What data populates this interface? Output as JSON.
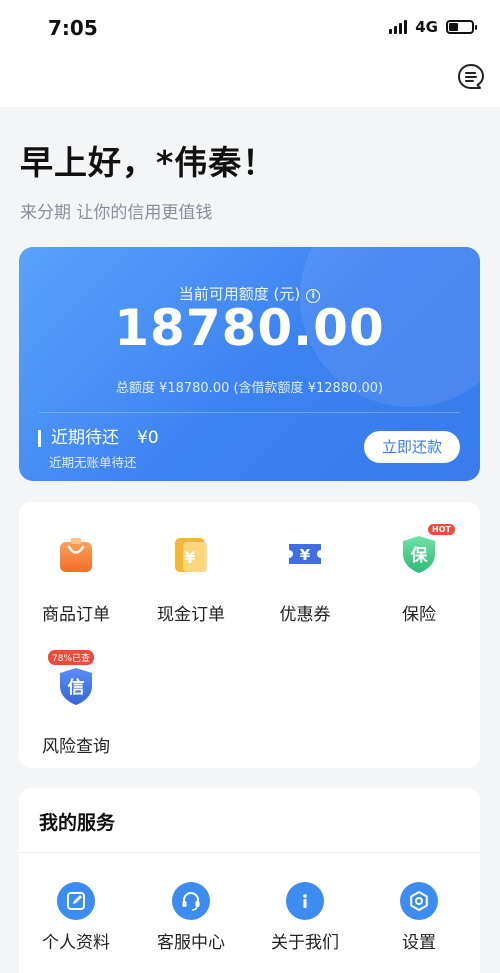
{
  "status_bar": {
    "time": "7:05",
    "network": "4G"
  },
  "header": {
    "greeting": "早上好，*伟秦！",
    "subtitle": "来分期 让你的信用更值钱"
  },
  "credit_card": {
    "label": "当前可用额度 (元)",
    "amount": "18780.00",
    "total_text": "总额度 ¥18780.00 (含借款额度 ¥12880.00)",
    "repay_label": "近期待还",
    "repay_amount": "¥0",
    "repay_sub": "近期无账单待还",
    "repay_button": "立即还款",
    "accent_color": "#3a7cec"
  },
  "quick_menu": {
    "items": [
      {
        "label": "商品订单",
        "icon": "shopping-bag-icon"
      },
      {
        "label": "现金订单",
        "icon": "cash-order-icon"
      },
      {
        "label": "优惠券",
        "icon": "coupon-icon"
      },
      {
        "label": "保险",
        "icon": "insurance-icon",
        "badge": "HOT"
      },
      {
        "label": "风险查询",
        "icon": "credit-shield-icon",
        "badge": "78%已查"
      }
    ]
  },
  "services": {
    "title": "我的服务",
    "items": [
      {
        "label": "个人资料",
        "icon": "edit-icon"
      },
      {
        "label": "客服中心",
        "icon": "headset-icon"
      },
      {
        "label": "关于我们",
        "icon": "info-icon"
      },
      {
        "label": "设置",
        "icon": "settings-icon"
      }
    ]
  }
}
